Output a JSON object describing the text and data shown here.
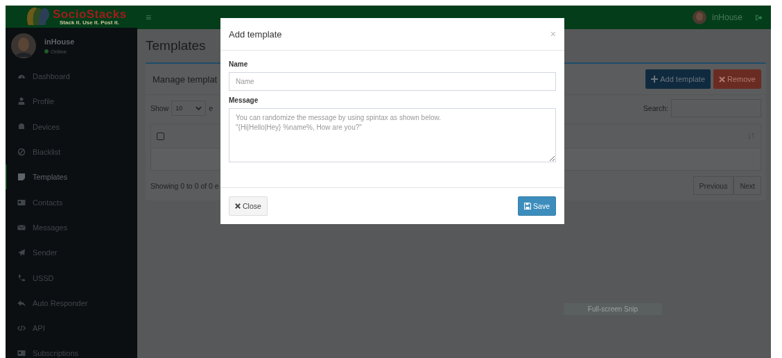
{
  "brand": {
    "name": "SocioStacks",
    "tagline": "Stack it. Use it.  Post it."
  },
  "header": {
    "menu_glyph": "≡",
    "user": "inHouse"
  },
  "user_panel": {
    "name": "inHouse",
    "status": "Online"
  },
  "sidebar": {
    "items": [
      {
        "label": "Dashboard",
        "selected": false
      },
      {
        "label": "Profile",
        "selected": false
      },
      {
        "label": "Devices",
        "selected": false
      },
      {
        "label": "Blacklist",
        "selected": false
      },
      {
        "label": "Templates",
        "selected": true
      },
      {
        "label": "Contacts",
        "selected": false
      },
      {
        "label": "Messages",
        "selected": false
      },
      {
        "label": "Sender",
        "selected": false
      },
      {
        "label": "USSD",
        "selected": false
      },
      {
        "label": "Auto Responder",
        "selected": false
      },
      {
        "label": "API",
        "selected": false
      },
      {
        "label": "Subscriptions",
        "selected": false
      }
    ]
  },
  "page": {
    "title": "Templates",
    "card_title": "Manage templat",
    "show_label": "Show",
    "page_size": "10",
    "entries_fragment": "e",
    "search_label": "Search:",
    "table": {
      "header_checked": false
    },
    "info": "Showing 0 to 0 of 0 e",
    "buttons": [
      {
        "kind": "add",
        "label": "Add template"
      },
      {
        "kind": "remove",
        "label": "Remove"
      }
    ],
    "pagination": [
      "Previous",
      "Next"
    ]
  },
  "modal": {
    "title": "Add template",
    "close_glyph": "×",
    "fields": [
      {
        "kind": "input",
        "label": "Name",
        "placeholder": "Name"
      },
      {
        "kind": "textarea",
        "label": "Message",
        "placeholder": "You can randomize the message by using spintax as shown below.\n\"{Hi|Hello|Hey} %name%, How are you?\""
      }
    ],
    "buttons": [
      {
        "kind": "close",
        "label": "Close"
      },
      {
        "kind": "save",
        "label": "Save"
      }
    ]
  },
  "snip_label": "Full-screen Snip"
}
